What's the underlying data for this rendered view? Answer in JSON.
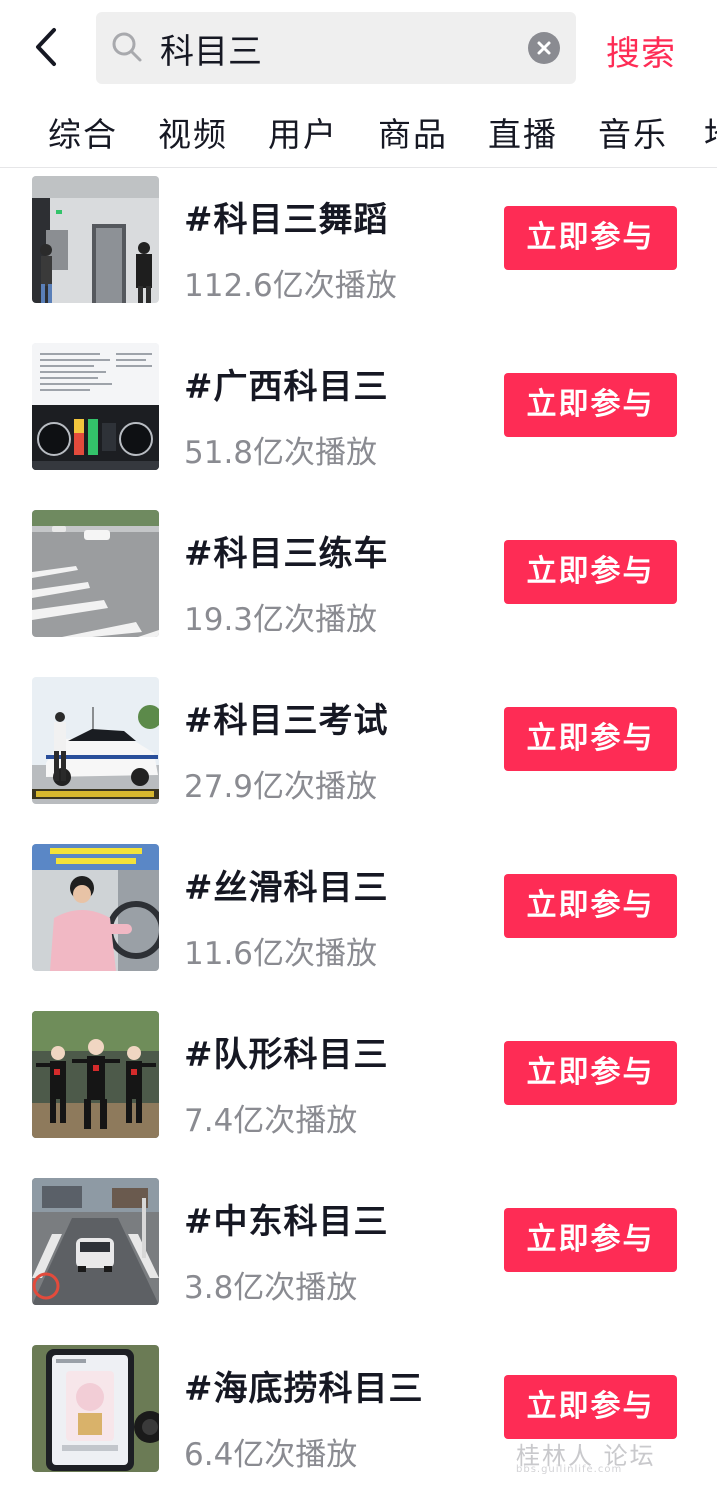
{
  "header": {
    "back_icon": "chevron-left-icon",
    "search_icon": "search-icon",
    "search_value": "科目三",
    "clear_icon": "clear-icon",
    "submit_label": "搜索",
    "accent_color": "#fe2c55"
  },
  "tabs": [
    {
      "label": "综合"
    },
    {
      "label": "视频"
    },
    {
      "label": "用户"
    },
    {
      "label": "商品"
    },
    {
      "label": "直播"
    },
    {
      "label": "音乐"
    },
    {
      "label": "地"
    }
  ],
  "results": [
    {
      "title": "#科目三舞蹈",
      "plays": "112.6亿次播放",
      "action": "立即参与"
    },
    {
      "title": "#广西科目三",
      "plays": "51.8亿次播放",
      "action": "立即参与"
    },
    {
      "title": "#科目三练车",
      "plays": "19.3亿次播放",
      "action": "立即参与"
    },
    {
      "title": "#科目三考试",
      "plays": "27.9亿次播放",
      "action": "立即参与"
    },
    {
      "title": "#丝滑科目三",
      "plays": "11.6亿次播放",
      "action": "立即参与"
    },
    {
      "title": "#队形科目三",
      "plays": "7.4亿次播放",
      "action": "立即参与"
    },
    {
      "title": "#中东科目三",
      "plays": "3.8亿次播放",
      "action": "立即参与"
    },
    {
      "title": "#海底捞科目三",
      "plays": "6.4亿次播放",
      "action": "立即参与"
    }
  ],
  "watermark": {
    "text": "桂林人 论坛",
    "url": "bbs.guilinlife.com"
  }
}
